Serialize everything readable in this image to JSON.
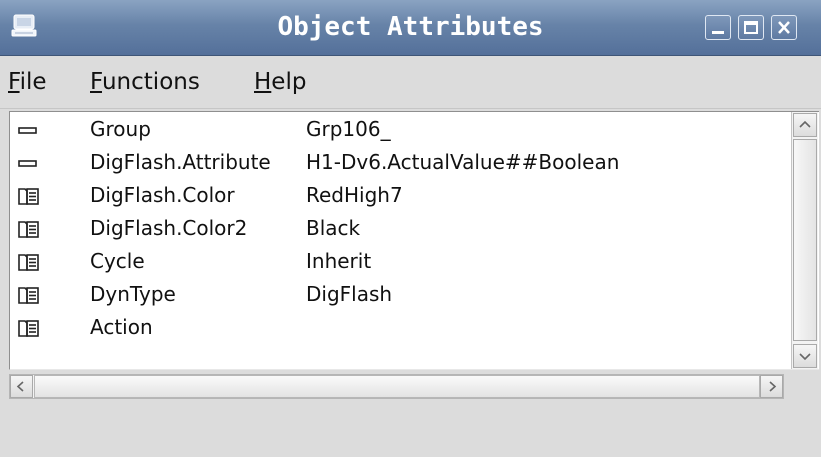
{
  "window": {
    "title": "Object Attributes",
    "app_icon": "computer-icon",
    "controls": [
      "minimize-icon",
      "maximize-icon",
      "close-icon"
    ]
  },
  "menu": {
    "file": {
      "mnemonic": "F",
      "rest": "ile"
    },
    "functions": {
      "mnemonic": "F",
      "rest": "unctions"
    },
    "help": {
      "mnemonic": "H",
      "rest": "elp"
    }
  },
  "attributes": [
    {
      "icon": "dash-icon",
      "name": "Group",
      "value": "Grp106_"
    },
    {
      "icon": "dash-icon",
      "name": "DigFlash.Attribute",
      "value": "H1-Dv6.ActualValue##Boolean"
    },
    {
      "icon": "folder-icon",
      "name": "DigFlash.Color",
      "value": "RedHigh7"
    },
    {
      "icon": "folder-icon",
      "name": "DigFlash.Color2",
      "value": "Black"
    },
    {
      "icon": "folder-icon",
      "name": "Cycle",
      "value": "Inherit"
    },
    {
      "icon": "folder-icon",
      "name": "DynType",
      "value": "DigFlash"
    },
    {
      "icon": "folder-icon",
      "name": "Action",
      "value": ""
    }
  ],
  "colors": {
    "titlebar": "#6783a8",
    "window_bg": "#dcdcdc",
    "list_bg": "#ffffff"
  }
}
